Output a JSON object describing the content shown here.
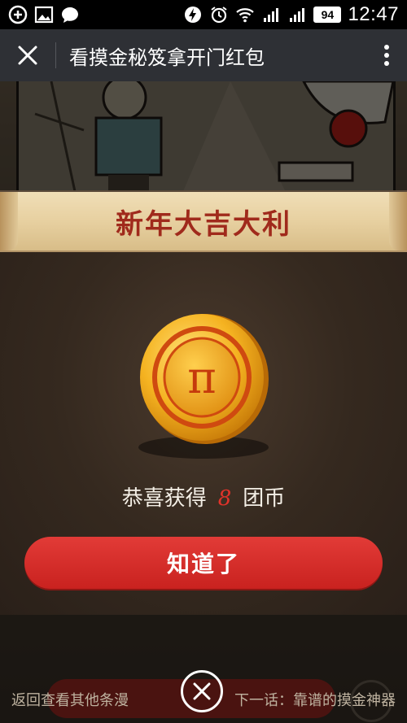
{
  "statusbar": {
    "left_icons": [
      "add-circle-icon",
      "image-icon",
      "chat-bubble-icon"
    ],
    "right_icons": [
      "power-saver-icon",
      "alarm-icon",
      "wifi-icon",
      "signal-icon",
      "signal-icon"
    ],
    "battery": "94",
    "time": "12:47"
  },
  "titlebar": {
    "title": "看摸金秘笈拿开门红包"
  },
  "background_page": {
    "left_link": "返回查看其他条漫",
    "right_link": "下一话：靠谱的摸金神器"
  },
  "modal": {
    "banner_title": "新年大吉大利",
    "reward_prefix": "恭喜获得",
    "reward_amount": "8",
    "reward_unit": "团币",
    "coin_symbol": "π",
    "confirm_label": "知道了"
  },
  "colors": {
    "accent_red": "#d82c28",
    "banner_text": "#a02a1c",
    "coin_gold": "#f5b321",
    "title_bar": "#2e3035"
  }
}
